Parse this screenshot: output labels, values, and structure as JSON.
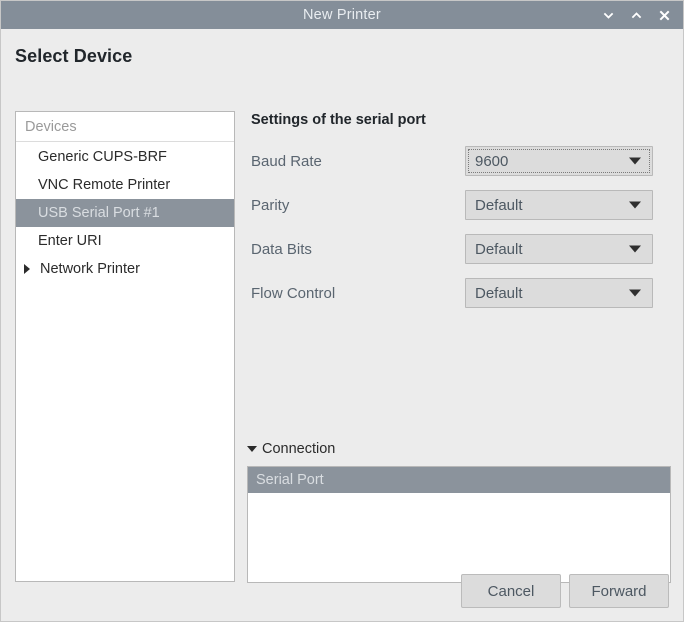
{
  "window": {
    "title": "New Printer",
    "buttons": [
      {
        "name": "minimize-button",
        "icon": "chevron-down-icon"
      },
      {
        "name": "maximize-button",
        "icon": "chevron-up-icon"
      },
      {
        "name": "close-button",
        "icon": "close-icon"
      }
    ]
  },
  "page": {
    "title": "Select Device"
  },
  "devices": {
    "header": "Devices",
    "items": [
      {
        "label": "Generic CUPS-BRF",
        "selected": false,
        "expandable": false
      },
      {
        "label": "VNC Remote Printer",
        "selected": false,
        "expandable": false
      },
      {
        "label": "USB Serial Port #1",
        "selected": true,
        "expandable": false
      },
      {
        "label": "Enter URI",
        "selected": false,
        "expandable": false
      },
      {
        "label": "Network Printer",
        "selected": false,
        "expandable": true
      }
    ]
  },
  "settings": {
    "title": "Settings of the serial port",
    "rows": [
      {
        "label": "Baud Rate",
        "value": "9600",
        "focused": true
      },
      {
        "label": "Parity",
        "value": "Default",
        "focused": false
      },
      {
        "label": "Data Bits",
        "value": "Default",
        "focused": false
      },
      {
        "label": "Flow Control",
        "value": "Default",
        "focused": false
      }
    ]
  },
  "connection": {
    "label": "Connection",
    "expanded": true,
    "items": [
      {
        "label": "Serial Port",
        "selected": true
      }
    ]
  },
  "footer": {
    "cancel_label": "Cancel",
    "forward_label": "Forward"
  },
  "colors": {
    "titlebar": "#848e99",
    "window_bg": "#ececec",
    "selection": "#8b939c",
    "selection_text": "#d9dde1",
    "label_text": "#5a6570",
    "control_bg": "#dcdcdc"
  }
}
